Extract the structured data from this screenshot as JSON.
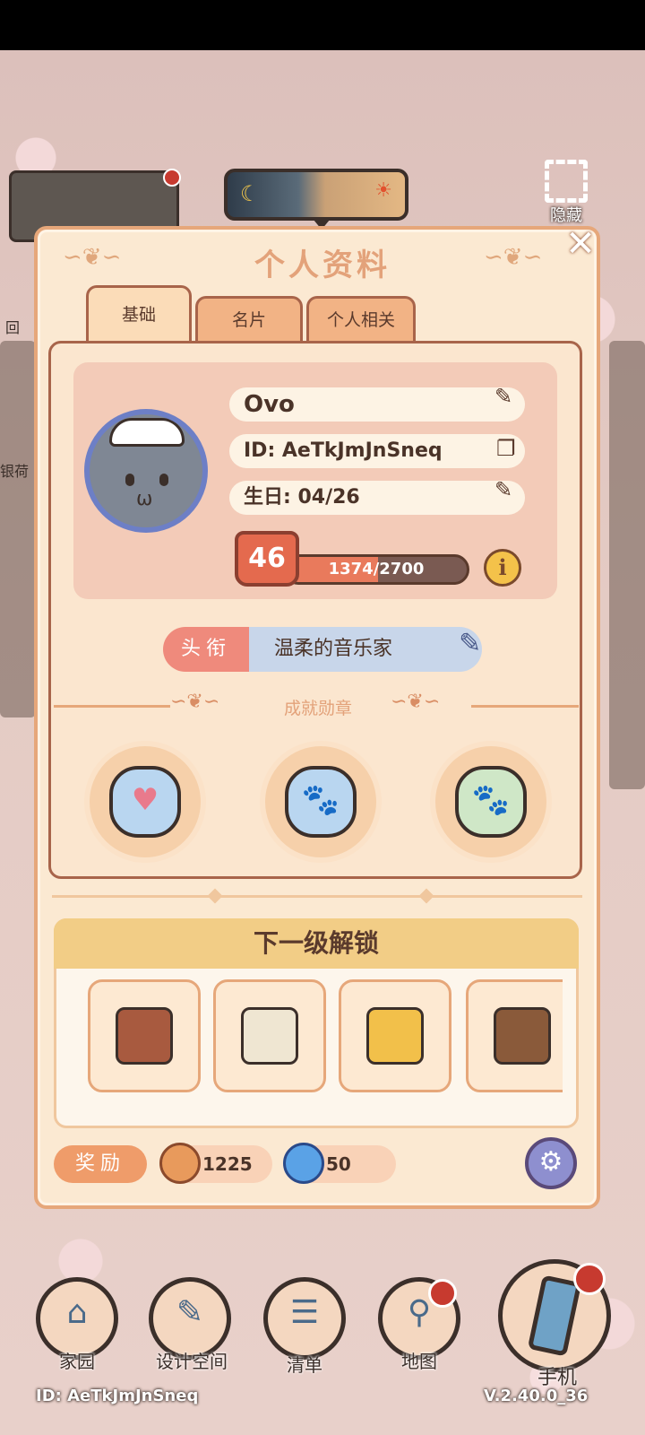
{
  "hud": {
    "hide_label": "隐藏",
    "back_label": "回",
    "silver_label": "银荷"
  },
  "panel": {
    "title": "个人资料",
    "close_glyph": "✕",
    "tabs": [
      {
        "label": "基础",
        "active": true
      },
      {
        "label": "名片",
        "active": false
      },
      {
        "label": "个人相关",
        "active": false
      }
    ]
  },
  "profile": {
    "name": "Ovo",
    "id_text": "ID: AeTkJmJnSneq",
    "birthday": "生日: 04/26",
    "level": "46",
    "xp_text": "1374/2700",
    "xp_fraction": 0.509,
    "info_glyph": "i",
    "title_label": "头衔",
    "title_value": "温柔的音乐家"
  },
  "achievements": {
    "label": "成就勋章",
    "badges": [
      {
        "name": "heart-message-badge",
        "glyph": "♥",
        "color": "#b9d6f0"
      },
      {
        "name": "blue-paw-badge",
        "glyph": "🐾",
        "color": "#b9d6f0"
      },
      {
        "name": "green-paw-badge",
        "glyph": "🐾",
        "color": "#cfe7c7"
      }
    ]
  },
  "unlock": {
    "header": "下一级解锁",
    "items": [
      {
        "name": "sink-cabinet",
        "color": "#a85a3f"
      },
      {
        "name": "air-fryer",
        "color": "#efe6d2"
      },
      {
        "name": "honey-jar",
        "color": "#f2c04a"
      },
      {
        "name": "jewelry-stand",
        "color": "#8a5a3a"
      }
    ]
  },
  "reward": {
    "label": "奖励",
    "coins": "1225",
    "gems": "50",
    "coin_color": "#e89a5c",
    "gem_color": "#5aa2e6"
  },
  "nav": {
    "items": [
      {
        "label": "家园",
        "icon": "home-icon",
        "glyph": "⌂"
      },
      {
        "label": "设计空间",
        "icon": "design-icon",
        "glyph": "✎"
      },
      {
        "label": "清单",
        "icon": "list-icon",
        "glyph": "☰"
      },
      {
        "label": "地图",
        "icon": "map-pin-icon",
        "glyph": "⚲"
      }
    ],
    "phone_label": "手机"
  },
  "footer": {
    "id": "ID:  AeTkJmJnSneq",
    "version": "V.2.40.0_36"
  },
  "colors": {
    "panel_bg": "#fbe9d2",
    "panel_border": "#e6a77a",
    "accent": "#e3a27a",
    "notification": "#c73a2f"
  }
}
